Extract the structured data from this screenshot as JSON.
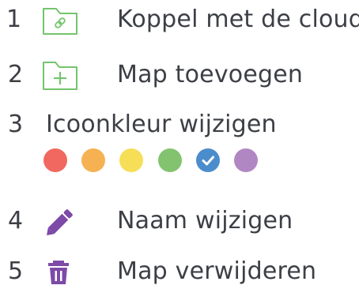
{
  "menu": {
    "items": [
      {
        "number": "1",
        "label": "Koppel met de cloud",
        "icon": "link-folder-icon"
      },
      {
        "number": "2",
        "label": "Map toevoegen",
        "icon": "add-folder-icon"
      },
      {
        "number": "3",
        "label": "Icoonkleur wijzigen",
        "icon": ""
      },
      {
        "number": "4",
        "label": "Naam wijzigen",
        "icon": "pencil-icon"
      },
      {
        "number": "5",
        "label": "Map verwijderen",
        "icon": "trash-icon"
      }
    ]
  },
  "colors": {
    "swatches": [
      "#f0685f",
      "#f6b152",
      "#f6de57",
      "#83c36f",
      "#4b8dcc",
      "#b187c3"
    ],
    "selected_index": 4,
    "folder_icon_green": "#73c56c",
    "edit_icon_purple": "#7d4aa8",
    "text": "#3c3f45"
  }
}
